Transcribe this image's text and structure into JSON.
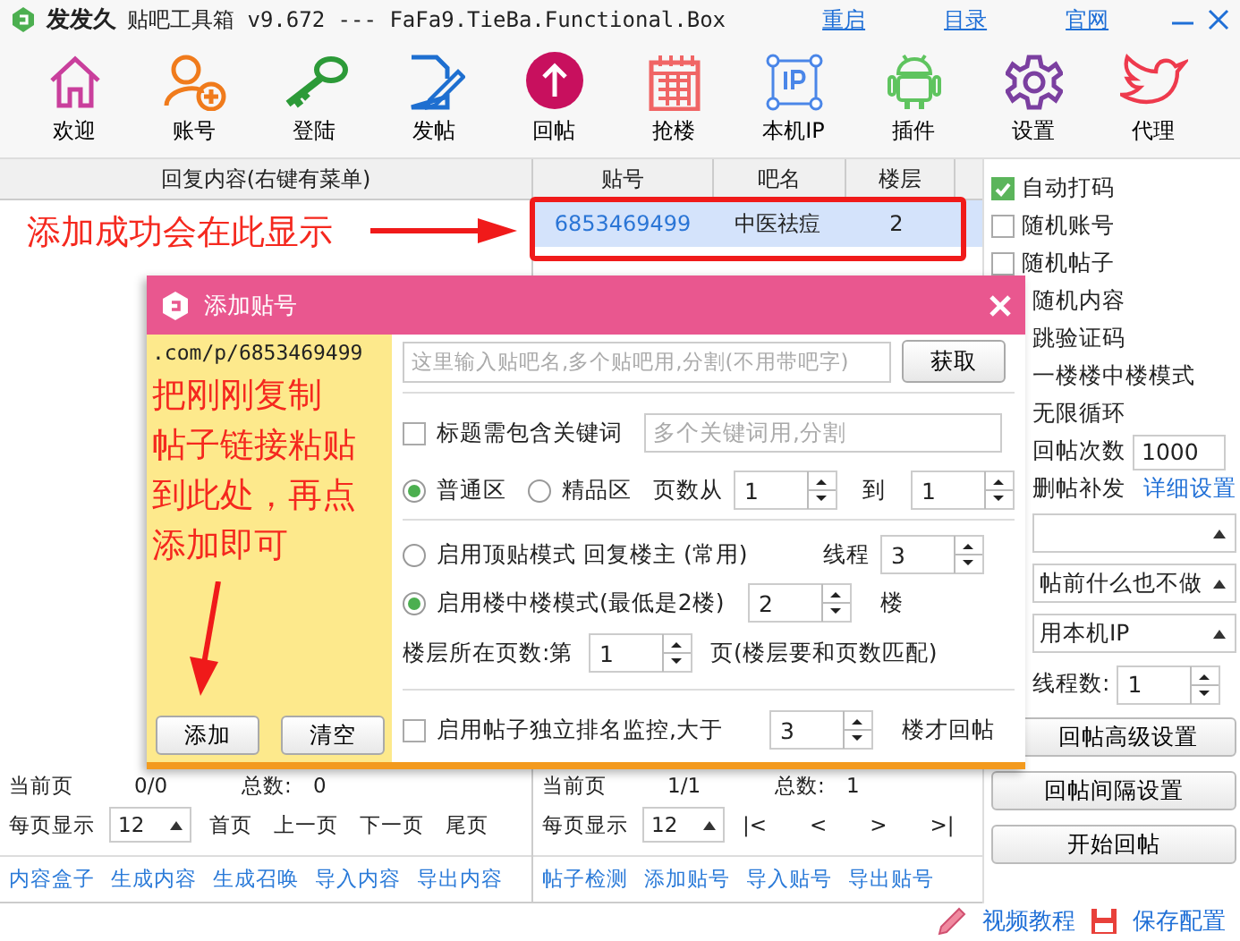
{
  "title_bar": {
    "app_name": "发发久",
    "title": "贴吧工具箱 v9.672 --- FaFa9.TieBa.Functional.Box",
    "links": [
      "重启",
      "目录",
      "官网"
    ]
  },
  "toolbar": [
    {
      "label": "欢迎"
    },
    {
      "label": "账号"
    },
    {
      "label": "登陆"
    },
    {
      "label": "发帖"
    },
    {
      "label": "回帖"
    },
    {
      "label": "抢楼"
    },
    {
      "label": "本机IP"
    },
    {
      "label": "插件"
    },
    {
      "label": "设置"
    },
    {
      "label": "代理"
    }
  ],
  "reply_table": {
    "columns": [
      "回复内容(右键有菜单)"
    ]
  },
  "post_table": {
    "columns": [
      "贴号",
      "吧名",
      "楼层"
    ],
    "rows": [
      {
        "cells": [
          "6853469499",
          "中医祛痘",
          "2"
        ],
        "selected": true
      }
    ]
  },
  "annotation": "添加成功会在此显示",
  "reply_pager": {
    "current_label": "当前页",
    "current": "0/0",
    "total_label": "总数:",
    "total": "0",
    "per_page_label": "每页显示",
    "per_page": "12",
    "nav": [
      "首页",
      "上一页",
      "下一页",
      "尾页"
    ],
    "links": [
      "内容盒子",
      "生成内容",
      "生成召唤",
      "导入内容",
      "导出内容"
    ]
  },
  "post_pager": {
    "current_label": "当前页",
    "current": "1/1",
    "total_label": "总数:",
    "total": "1",
    "per_page_label": "每页显示",
    "per_page": "12",
    "nav": [
      "|<",
      "<",
      ">",
      ">|"
    ],
    "links": [
      "帖子检测",
      "添加贴号",
      "导入贴号",
      "导出贴号"
    ]
  },
  "options": {
    "checks": [
      {
        "label": "自动打码",
        "checked": true
      },
      {
        "label": "随机账号",
        "checked": false
      },
      {
        "label": "随机帖子",
        "checked": false
      }
    ],
    "covered_labels": [
      "随机内容",
      "跳验证码",
      "一楼楼中楼模式",
      "无限循环"
    ],
    "reply_count_label": "回帖次数",
    "reply_count": "1000",
    "resend_label": "删帖补发",
    "detail_link": "详细设置",
    "dropdowns": [
      {
        "kind": "blank"
      },
      {
        "kind": "text",
        "value": "帖前什么也不做"
      },
      {
        "kind": "text",
        "value": "用本机IP"
      }
    ],
    "threads_label": "线程数:",
    "threads": "1",
    "buttons": [
      "回帖高级设置",
      "回帖间隔设置",
      "开始回帖"
    ]
  },
  "footer": {
    "links": [
      "视频教程",
      "保存配置"
    ]
  },
  "dialog": {
    "title": "添加贴号",
    "url_text": ".com/p/6853469499",
    "instruction_lines": [
      "把刚刚复制",
      "帖子链接粘贴",
      "到此处，再点",
      "添加即可"
    ],
    "buttons": [
      "添加",
      "清空"
    ],
    "name_placeholder": "这里输入贴吧名,多个贴吧用,分割(不用带吧字)",
    "fetch_button": "获取",
    "keyword_check": {
      "label": "标题需包含关键词",
      "checked": false
    },
    "keyword_placeholder": "多个关键词用,分割",
    "zones": [
      {
        "label": "普通区",
        "selected": true
      },
      {
        "label": "精品区",
        "selected": false
      }
    ],
    "pages_from_label": "页数从",
    "pages_from": "1",
    "pages_to_label": "到",
    "pages_to": "1",
    "modes": [
      {
        "label": "启用顶贴模式 回复楼主 (常用)",
        "selected": false
      },
      {
        "label": "启用楼中楼模式(最低是2楼)",
        "selected": true
      }
    ],
    "threads_label": "线程",
    "threads": "3",
    "floor": "2",
    "floor_unit": "楼",
    "floor_page_label": "楼层所在页数:第",
    "floor_page": "1",
    "floor_page_hint": "页(楼层要和页数匹配)",
    "monitor_check": {
      "label": "启用帖子独立排名监控,大于",
      "checked": false
    },
    "monitor_value": "3",
    "monitor_unit": "楼才回帖"
  }
}
